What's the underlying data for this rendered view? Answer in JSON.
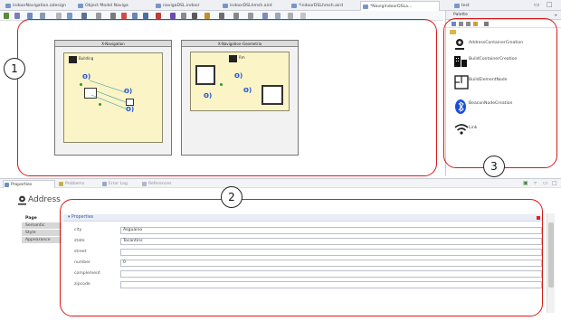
{
  "editor_tabs": [
    {
      "label": "indoorNavigation.odesign"
    },
    {
      "label": "Object Model Naviga"
    },
    {
      "label": "navigaDSL.indoor"
    },
    {
      "label": "indoorDSLhmsh.aird"
    },
    {
      "label": "*indoorDSLhmsh.aird"
    },
    {
      "label": "*NavigIndoorDSLa..."
    },
    {
      "label": "test"
    }
  ],
  "diagram": {
    "frame1_title": "X-Navigation",
    "frame2_title": "X-Navigation-Geometria",
    "container1_label": "Building",
    "container2_label": "Rm"
  },
  "palette": {
    "title": "Palette",
    "items": [
      {
        "label": "AddressContainerCreation",
        "icon": "location-pin-icon"
      },
      {
        "label": "BuildContainerCreation",
        "icon": "building-icon"
      },
      {
        "label": "BuildElementNode",
        "icon": "floorplan-icon"
      },
      {
        "label": "BeaconNodeCreation",
        "icon": "bluetooth-icon"
      },
      {
        "label": "Link",
        "icon": "wifi-icon"
      }
    ]
  },
  "properties_tabs": [
    {
      "label": "Properties",
      "active": true
    },
    {
      "label": "Problems",
      "active": false
    },
    {
      "label": "Error Log",
      "active": false
    },
    {
      "label": "References",
      "active": false
    }
  ],
  "properties": {
    "title": "Address",
    "side_tabs": [
      "Page",
      "Semantic",
      "Style",
      "Appearance"
    ],
    "section_title": "Properties",
    "fields": [
      {
        "label": "city",
        "value": "Asguaino"
      },
      {
        "label": "state",
        "value": "Tocantins"
      },
      {
        "label": "street",
        "value": ""
      },
      {
        "label": "number",
        "value": "0"
      },
      {
        "label": "complement",
        "value": ""
      },
      {
        "label": "zipcode",
        "value": ""
      }
    ]
  },
  "annotations": [
    {
      "label": "1"
    },
    {
      "label": "2"
    },
    {
      "label": "3"
    }
  ],
  "colors": {
    "highlight": "#d81a1a",
    "container": "#fbf4c6",
    "beacon_blue": "#1b4fd8"
  }
}
